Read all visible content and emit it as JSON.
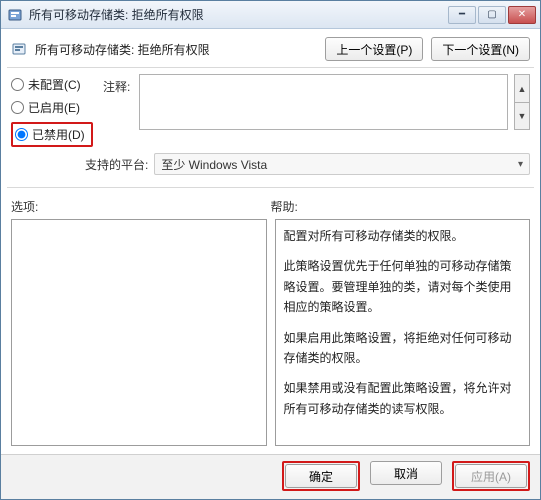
{
  "window": {
    "title": "所有可移动存储类: 拒绝所有权限"
  },
  "header": {
    "subtitle": "所有可移动存储类: 拒绝所有权限",
    "prev_btn": "上一个设置(P)",
    "next_btn": "下一个设置(N)"
  },
  "radios": {
    "not_configured": "未配置(C)",
    "enabled": "已启用(E)",
    "disabled": "已禁用(D)"
  },
  "comment": {
    "label": "注释:",
    "value": ""
  },
  "platform": {
    "label": "支持的平台:",
    "value": "至少 Windows Vista"
  },
  "panes": {
    "options_label": "选项:",
    "help_label": "帮助:"
  },
  "help_text": {
    "p1": "配置对所有可移动存储类的权限。",
    "p2": "此策略设置优先于任何单独的可移动存储策略设置。要管理单独的类，请对每个类使用相应的策略设置。",
    "p3": "如果启用此策略设置，将拒绝对任何可移动存储类的权限。",
    "p4": "如果禁用或没有配置此策略设置，将允许对所有可移动存储类的读写权限。"
  },
  "footer": {
    "ok": "确定",
    "cancel": "取消",
    "apply": "应用(A)"
  }
}
